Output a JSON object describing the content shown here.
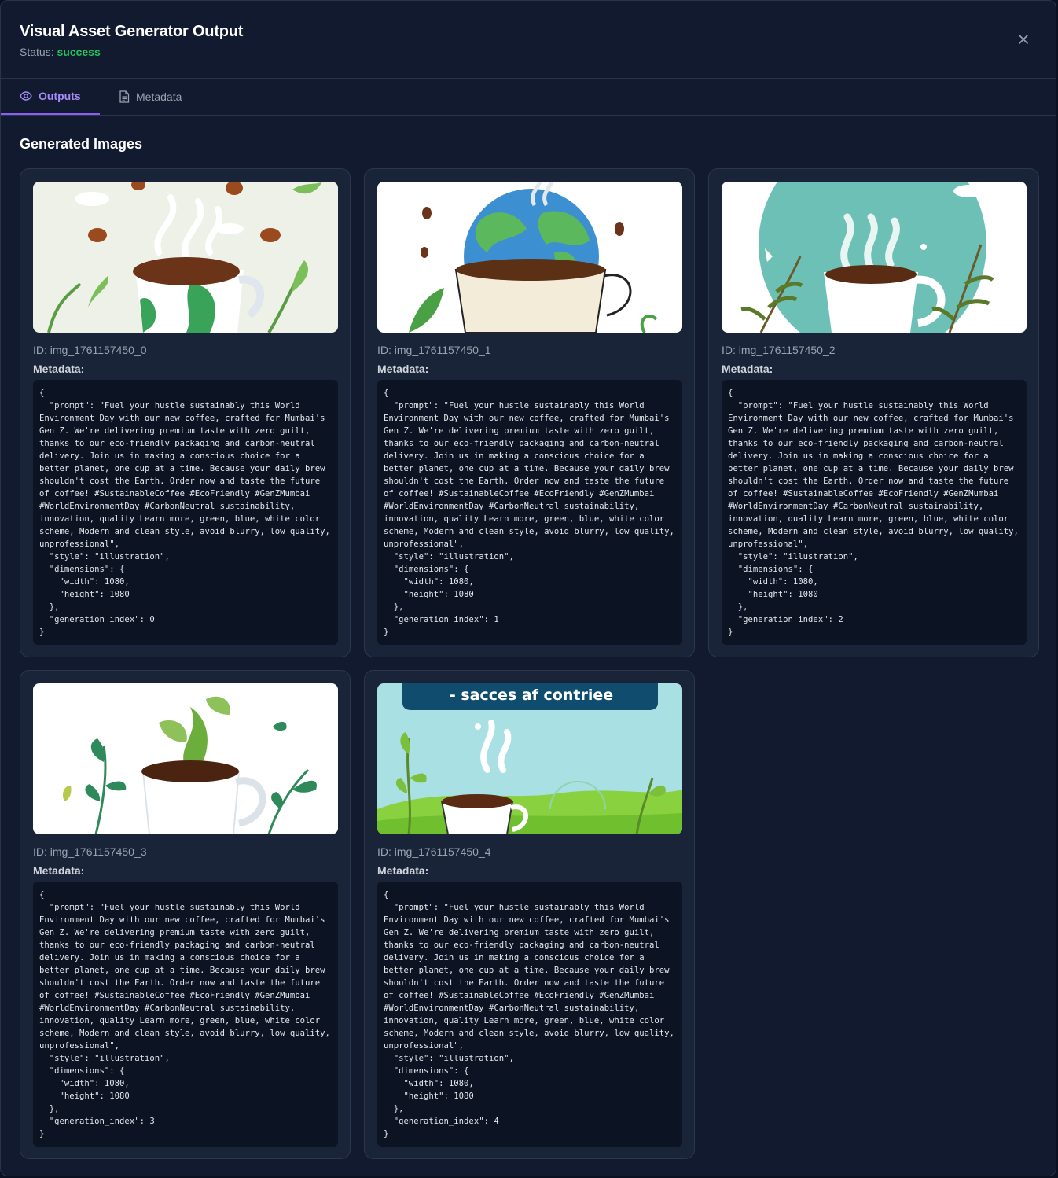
{
  "header": {
    "title": "Visual Asset Generator Output",
    "status_label": "Status:",
    "status_value": "success",
    "close_icon": "close-icon",
    "status_color": "#22c55e"
  },
  "tabs": [
    {
      "label": "Outputs",
      "icon": "eye-icon",
      "active": true
    },
    {
      "label": "Metadata",
      "icon": "document-icon",
      "active": false
    }
  ],
  "section_title": "Generated Images",
  "accent": "#8b5cf6",
  "images": [
    {
      "id_text": "ID: img_1761157450_0",
      "meta_label": "Metadata:",
      "metadata": "{\n  \"prompt\": \"Fuel your hustle sustainably this World Environment Day with our new coffee, crafted for Mumbai's Gen Z. We're delivering premium taste with zero guilt, thanks to our eco-friendly packaging and carbon-neutral delivery. Join us in making a conscious choice for a better planet, one cup at a time. Because your daily brew shouldn't cost the Earth. Order now and taste the future of coffee! #SustainableCoffee #EcoFriendly #GenZMumbai #WorldEnvironmentDay #CarbonNeutral sustainability, innovation, quality Learn more, green, blue, white color scheme, Modern and clean style, avoid blurry, low quality, unprofessional\",\n  \"style\": \"illustration\",\n  \"dimensions\": {\n    \"width\": 1080,\n    \"height\": 1080\n  },\n  \"generation_index\": 0\n}"
    },
    {
      "id_text": "ID: img_1761157450_1",
      "meta_label": "Metadata:",
      "metadata": "{\n  \"prompt\": \"Fuel your hustle sustainably this World Environment Day with our new coffee, crafted for Mumbai's Gen Z. We're delivering premium taste with zero guilt, thanks to our eco-friendly packaging and carbon-neutral delivery. Join us in making a conscious choice for a better planet, one cup at a time. Because your daily brew shouldn't cost the Earth. Order now and taste the future of coffee! #SustainableCoffee #EcoFriendly #GenZMumbai #WorldEnvironmentDay #CarbonNeutral sustainability, innovation, quality Learn more, green, blue, white color scheme, Modern and clean style, avoid blurry, low quality, unprofessional\",\n  \"style\": \"illustration\",\n  \"dimensions\": {\n    \"width\": 1080,\n    \"height\": 1080\n  },\n  \"generation_index\": 1\n}"
    },
    {
      "id_text": "ID: img_1761157450_2",
      "meta_label": "Metadata:",
      "metadata": "{\n  \"prompt\": \"Fuel your hustle sustainably this World Environment Day with our new coffee, crafted for Mumbai's Gen Z. We're delivering premium taste with zero guilt, thanks to our eco-friendly packaging and carbon-neutral delivery. Join us in making a conscious choice for a better planet, one cup at a time. Because your daily brew shouldn't cost the Earth. Order now and taste the future of coffee! #SustainableCoffee #EcoFriendly #GenZMumbai #WorldEnvironmentDay #CarbonNeutral sustainability, innovation, quality Learn more, green, blue, white color scheme, Modern and clean style, avoid blurry, low quality, unprofessional\",\n  \"style\": \"illustration\",\n  \"dimensions\": {\n    \"width\": 1080,\n    \"height\": 1080\n  },\n  \"generation_index\": 2\n}"
    },
    {
      "id_text": "ID: img_1761157450_3",
      "meta_label": "Metadata:",
      "metadata": "{\n  \"prompt\": \"Fuel your hustle sustainably this World Environment Day with our new coffee, crafted for Mumbai's Gen Z. We're delivering premium taste with zero guilt, thanks to our eco-friendly packaging and carbon-neutral delivery. Join us in making a conscious choice for a better planet, one cup at a time. Because your daily brew shouldn't cost the Earth. Order now and taste the future of coffee! #SustainableCoffee #EcoFriendly #GenZMumbai #WorldEnvironmentDay #CarbonNeutral sustainability, innovation, quality Learn more, green, blue, white color scheme, Modern and clean style, avoid blurry, low quality, unprofessional\",\n  \"style\": \"illustration\",\n  \"dimensions\": {\n    \"width\": 1080,\n    \"height\": 1080\n  },\n  \"generation_index\": 3\n}"
    },
    {
      "id_text": "ID: img_1761157450_4",
      "meta_label": "Metadata:",
      "banner_text": "- sacces af contriee",
      "metadata": "{\n  \"prompt\": \"Fuel your hustle sustainably this World Environment Day with our new coffee, crafted for Mumbai's Gen Z. We're delivering premium taste with zero guilt, thanks to our eco-friendly packaging and carbon-neutral delivery. Join us in making a conscious choice for a better planet, one cup at a time. Because your daily brew shouldn't cost the Earth. Order now and taste the future of coffee! #SustainableCoffee #EcoFriendly #GenZMumbai #WorldEnvironmentDay #CarbonNeutral sustainability, innovation, quality Learn more, green, blue, white color scheme, Modern and clean style, avoid blurry, low quality, unprofessional\",\n  \"style\": \"illustration\",\n  \"dimensions\": {\n    \"width\": 1080,\n    \"height\": 1080\n  },\n  \"generation_index\": 4\n}"
    }
  ]
}
